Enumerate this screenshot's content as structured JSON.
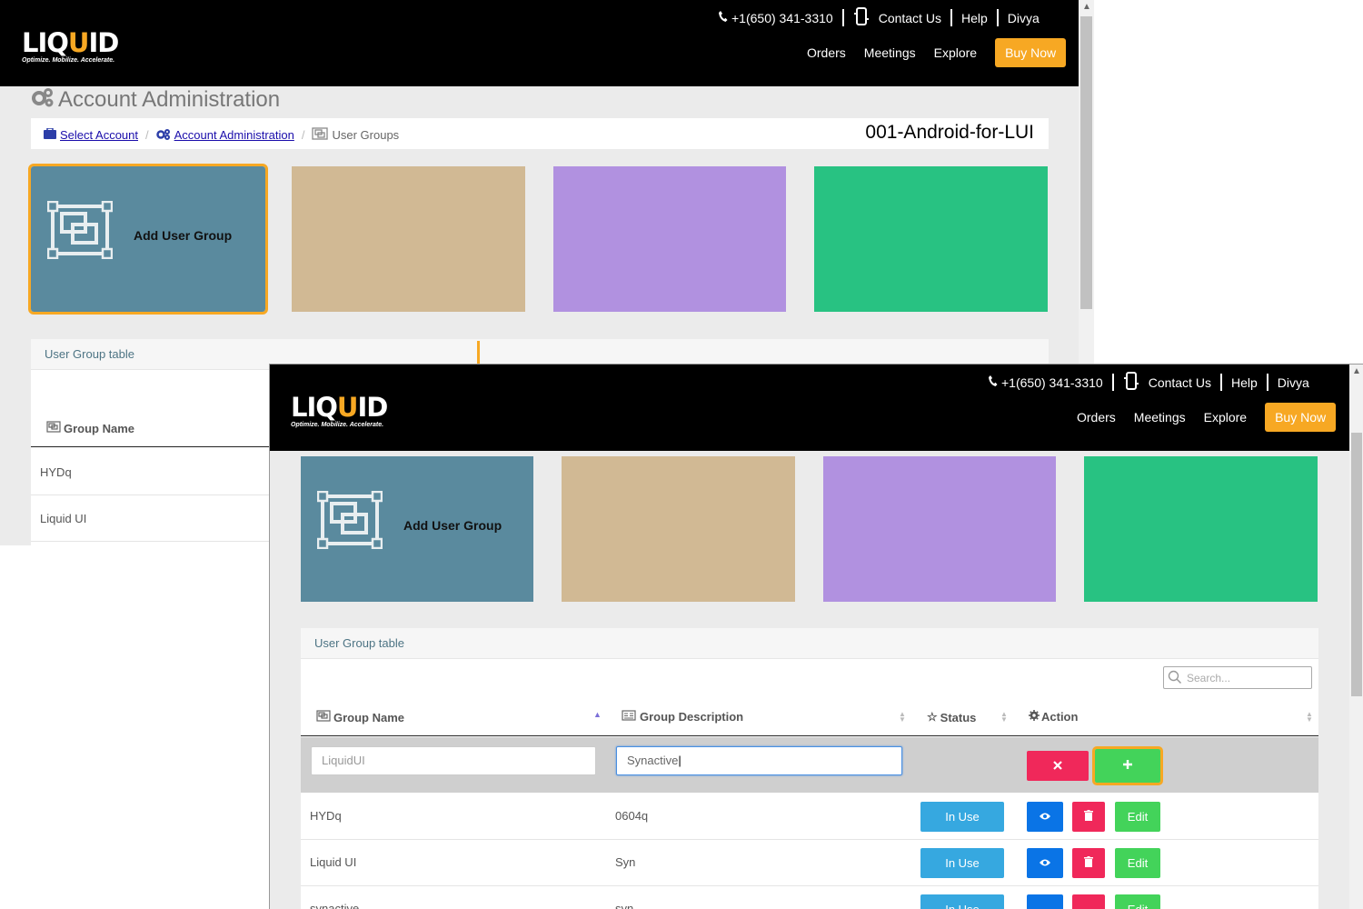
{
  "header": {
    "phone": "+1(650) 341-3310",
    "contact_us": "Contact Us",
    "help": "Help",
    "user": "Divya",
    "nav": [
      "Orders",
      "Meetings",
      "Explore"
    ],
    "buy_now": "Buy Now",
    "logo_text_pre": "LIQ",
    "logo_text_u": "U",
    "logo_text_post": "ID",
    "logo_tagline": "Optimize. Mobilize. Accelerate."
  },
  "page": {
    "title": "Account Administration",
    "breadcrumb": {
      "select_account": "Select Account",
      "account_admin": "Account Administration",
      "current": "User Groups"
    },
    "account_id": "001-Android-for-LUI"
  },
  "tiles": {
    "add_user_group": "Add User Group",
    "colors": [
      "#5a8a9e",
      "#d1b994",
      "#b191e0",
      "#28c282"
    ]
  },
  "table": {
    "title": "User Group table",
    "search_placeholder": "Search...",
    "columns": [
      "Group Name",
      "Group Description",
      "Status",
      "Action"
    ],
    "new_row": {
      "name_value": "LiquidUI",
      "description_value": "Synactive"
    },
    "rows": [
      {
        "name": "HYDq",
        "description": "0604q",
        "status": "In Use",
        "edit": "Edit"
      },
      {
        "name": "Liquid UI",
        "description": "Syn",
        "status": "In Use",
        "edit": "Edit"
      },
      {
        "name": "synactive",
        "description": "syn",
        "status": "In Use",
        "edit": "Edit"
      }
    ]
  },
  "colors": {
    "accent": "#f7a823",
    "cancel": "#f0285a",
    "add": "#43d35a",
    "view": "#0a74e6",
    "status": "#36a8e0"
  }
}
